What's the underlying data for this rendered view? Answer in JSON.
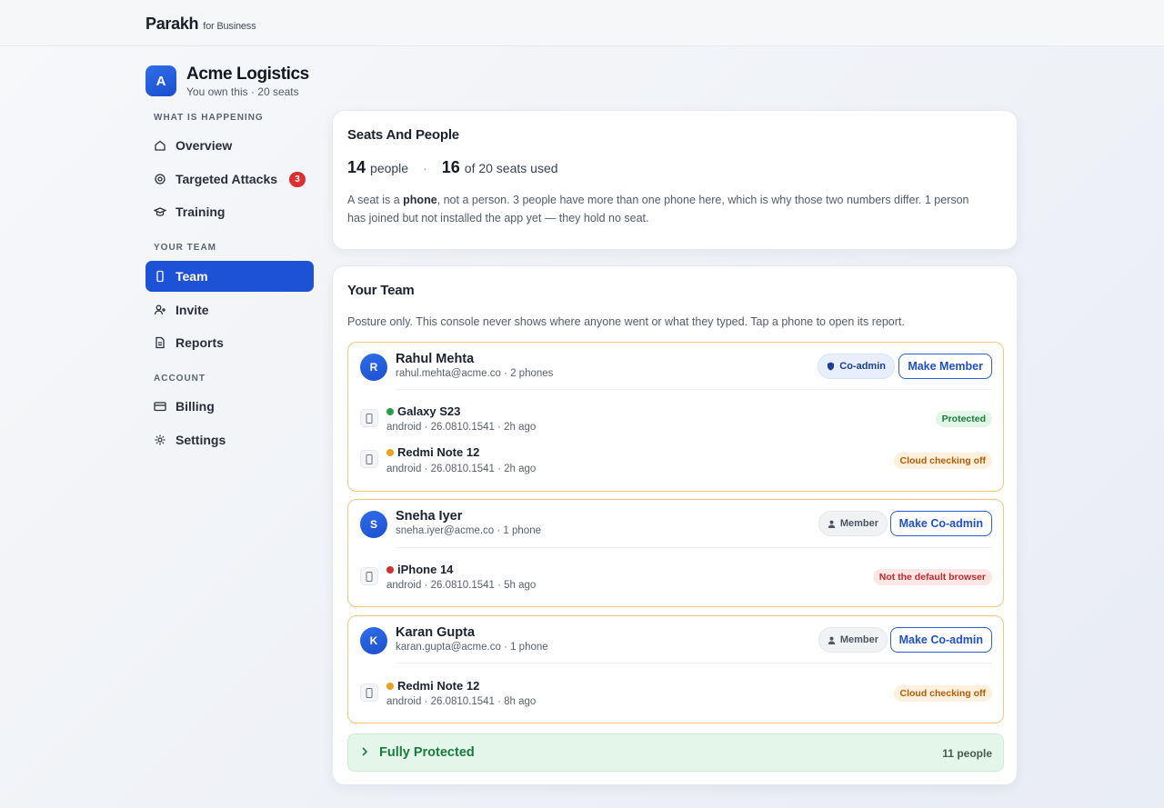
{
  "app": {
    "name": "Parakh",
    "suffix": "for Business"
  },
  "org": {
    "initial": "A",
    "name": "Acme Logistics",
    "meta": "You own this · 20 seats"
  },
  "nav": {
    "section1": "WHAT IS HAPPENING",
    "overview": "Overview",
    "attacks": "Targeted Attacks",
    "attacks_badge": "3",
    "training": "Training",
    "section2": "YOUR TEAM",
    "team": "Team",
    "invite": "Invite",
    "reports": "Reports",
    "section3": "ACCOUNT",
    "billing": "Billing",
    "settings": "Settings"
  },
  "seats": {
    "title": "Seats And People",
    "people_count": "14",
    "people_label": "people",
    "seats_used": "16",
    "seats_label": "of 20 seats used",
    "note_pre": "A seat is a ",
    "note_bold": "phone",
    "note_post": ", not a person. 3 people have more than one phone here, which is why those two numbers differ. 1 person has joined but not installed the app yet — they hold no seat."
  },
  "team": {
    "title": "Your Team",
    "subtitle": "Posture only. This console never shows where anyone went or what they typed. Tap a phone to open its report.",
    "people": [
      {
        "initial": "R",
        "name": "Rahul Mehta",
        "meta": "rahul.mehta@acme.co · 2 phones",
        "role": "Co-admin",
        "action": "Make Member",
        "devices": [
          {
            "name": "Galaxy S23",
            "meta": "android · 26.0810.1541 · 2h ago",
            "status": "Protected",
            "dot": "#22a04b"
          },
          {
            "name": "Redmi Note 12",
            "meta": "android · 26.0810.1541 · 2h ago",
            "status": "Cloud checking off",
            "dot": "#eea21a"
          }
        ]
      },
      {
        "initial": "S",
        "name": "Sneha Iyer",
        "meta": "sneha.iyer@acme.co · 1 phone",
        "role": "Member",
        "action": "Make Co-admin",
        "devices": [
          {
            "name": "iPhone 14",
            "meta": "android · 26.0810.1541 · 5h ago",
            "status": "Not the default browser",
            "dot": "#d62d2d"
          }
        ]
      },
      {
        "initial": "K",
        "name": "Karan Gupta",
        "meta": "karan.gupta@acme.co · 1 phone",
        "role": "Member",
        "action": "Make Co-admin",
        "devices": [
          {
            "name": "Redmi Note 12",
            "meta": "android · 26.0810.1541 · 8h ago",
            "status": "Cloud checking off",
            "dot": "#eea21a"
          }
        ]
      }
    ],
    "fully_protected": {
      "label": "Fully Protected",
      "count": "11 people"
    }
  },
  "colors": {
    "accent": "#1d51d6",
    "warning_border": "#f1c77b",
    "success": "#1c7a3f"
  }
}
